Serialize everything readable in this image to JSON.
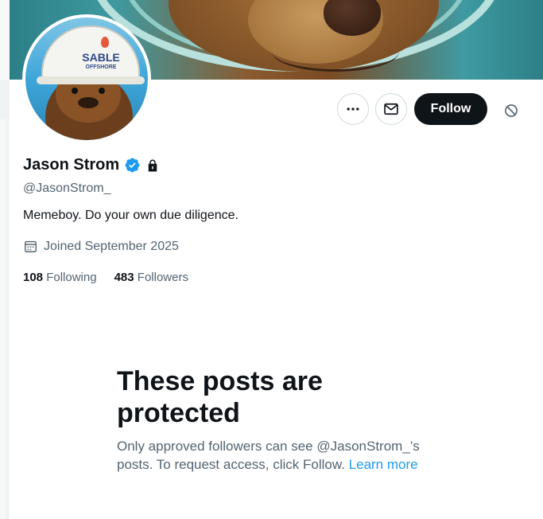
{
  "profile": {
    "name": "Jason Strom",
    "handle": "@JasonStrom_",
    "bio": "Memeboy. Do your own due diligence.",
    "joined": "Joined September 2025",
    "verified": true,
    "protected": true,
    "avatar_helmet_text_line1": "SABLE",
    "avatar_helmet_text_line2": "OFFSHORE"
  },
  "stats": {
    "following_count": "108",
    "following_label": "Following",
    "followers_count": "483",
    "followers_label": "Followers"
  },
  "actions": {
    "follow_label": "Follow",
    "more_icon": "more-icon",
    "message_icon": "envelope-icon",
    "block_icon": "block-icon"
  },
  "protected_notice": {
    "title": "These posts are protected",
    "body": "Only approved followers can see @JasonStrom_’s posts. To request access, click Follow.",
    "link_label": "Learn more"
  },
  "colors": {
    "accent_blue": "#1d9bf0",
    "text_primary": "#0f1419",
    "text_secondary": "#536471",
    "follow_button_bg": "#0f1419"
  }
}
